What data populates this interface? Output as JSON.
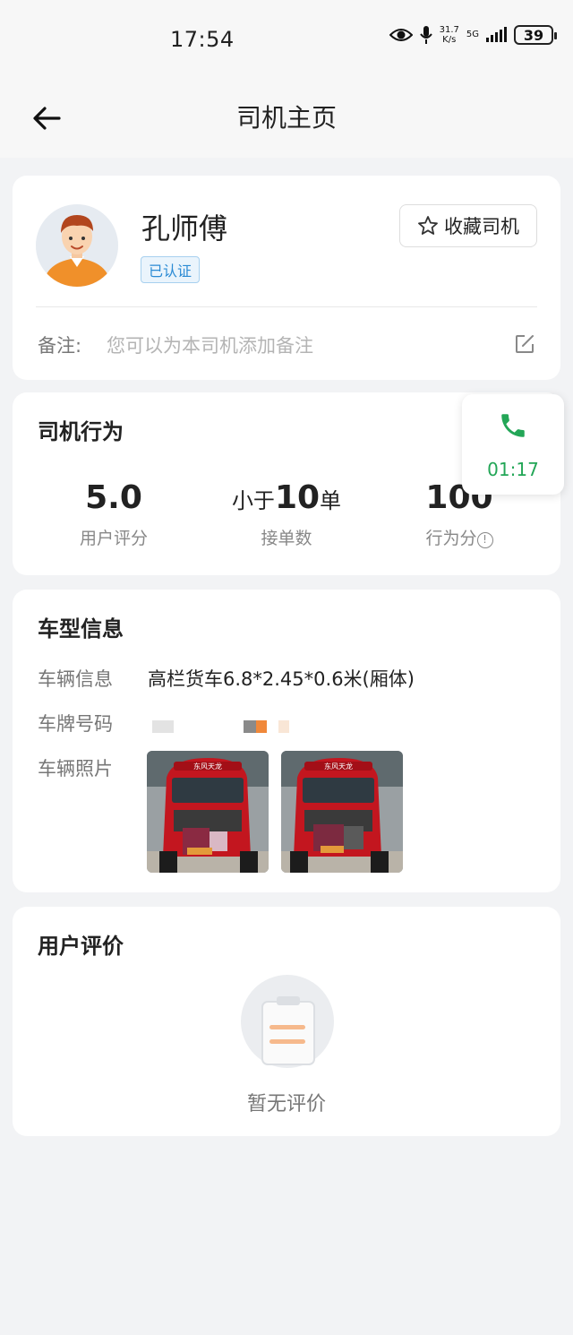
{
  "status_bar": {
    "time": "17:54",
    "net_speed_value": "31.7",
    "net_speed_unit": "K/s",
    "network_type": "5G",
    "battery": "39"
  },
  "header": {
    "title": "司机主页"
  },
  "driver": {
    "name": "孔师傅",
    "verified_label": "已认证",
    "favorite_label": "收藏司机",
    "remark_label": "备注:",
    "remark_placeholder": "您可以为本司机添加备注"
  },
  "behavior": {
    "title": "司机行为",
    "stats": [
      {
        "value": "5.0",
        "label": "用户评分"
      },
      {
        "value_prefix": "小于",
        "value": "10",
        "value_suffix": "单",
        "label": "接单数"
      },
      {
        "value": "100",
        "label": "行为分"
      }
    ],
    "call_timer": "01:17"
  },
  "vehicle": {
    "title": "车型信息",
    "info_label": "车辆信息",
    "info_value": "高栏货车6.8*2.45*0.6米(厢体)",
    "plate_label": "车牌号码",
    "photos_label": "车辆照片",
    "truck_banner_text": "东风天龙"
  },
  "reviews": {
    "title": "用户评价",
    "empty_text": "暂无评价"
  },
  "colors": {
    "accent_green": "#23a657",
    "verified_blue": "#2a8ad4",
    "background": "#f2f3f5"
  }
}
